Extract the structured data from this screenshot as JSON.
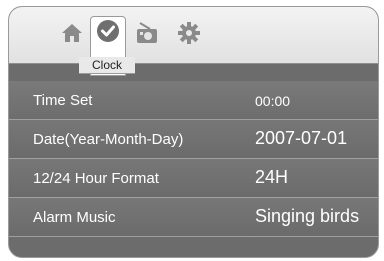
{
  "tabs": [
    {
      "icon": "home-icon"
    },
    {
      "icon": "clock-icon",
      "label": "Clock",
      "selected": true
    },
    {
      "icon": "radio-icon"
    },
    {
      "icon": "gear-icon"
    }
  ],
  "settings": [
    {
      "label": "Time  Set",
      "value": "00:00"
    },
    {
      "label": "Date(Year-Month-Day)",
      "value": "2007-07-01"
    },
    {
      "label": "12/24 Hour Format",
      "value": "24H"
    },
    {
      "label": "Alarm Music",
      "value": "Singing birds"
    }
  ]
}
